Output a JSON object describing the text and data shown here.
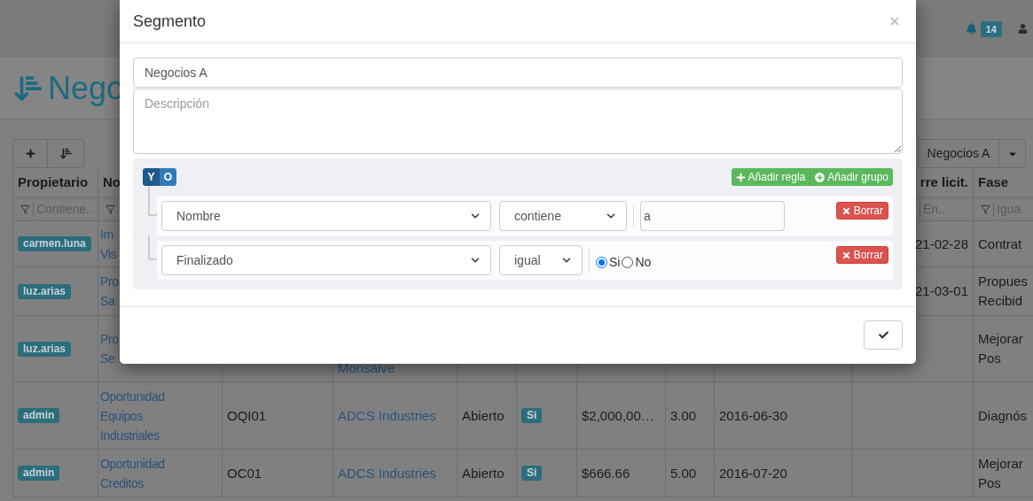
{
  "navbar": {
    "notification_count": "14"
  },
  "page": {
    "title": "Nego"
  },
  "segment_dropdown": {
    "value": "Negocios A"
  },
  "table": {
    "header": {
      "owner": "Propietario",
      "name": "No",
      "close_date": "rre licit.",
      "phase": "Fase"
    },
    "filters": {
      "owner": {
        "placeholder": "Contiene..",
        "funnel": true
      },
      "name": {
        "funnel": true
      },
      "close_date": {
        "placeholder": "En.."
      },
      "phase": {
        "placeholder": "Igua",
        "funnel": true
      }
    },
    "rows": [
      {
        "owner": "carmen.luna",
        "name": "Im\nVis",
        "close_date": "21-02-28",
        "phase": "Contrat"
      },
      {
        "owner": "luz.arias",
        "name": "Pro\nSa",
        "close_date": "21-03-01",
        "phase": "Propues\nRecibid"
      },
      {
        "owner": "luz.arias",
        "name": "Pro\nSe",
        "client": "Monsalve",
        "phase": "Mejorar\nPos"
      },
      {
        "owner": "admin",
        "name": "Oportunidad\nEquipos\nIndustriales",
        "code": "OQI01",
        "client": "ADCS Industries",
        "status": "Abierto",
        "won": "Si",
        "amount": "$2,000,00…",
        "probability": "3.00",
        "date": "2016-06-30",
        "phase": "Diagnós"
      },
      {
        "owner": "admin",
        "name": "Oportunidad\nCreditos",
        "code": "OC01",
        "client": "ADCS Industries",
        "status": "Abierto",
        "won": "Si",
        "amount": "$666.66",
        "probability": "5.00",
        "date": "2016-07-20",
        "phase": "Mejorar\nPos"
      }
    ]
  },
  "modal": {
    "title": "Segmento",
    "name_value": "Negocios A",
    "description_placeholder": "Descripción",
    "conditions": [
      {
        "label": "Y",
        "selected": true
      },
      {
        "label": "O",
        "selected": false
      }
    ],
    "actions": [
      {
        "kind": "rule",
        "label": "Añadir regla"
      },
      {
        "kind": "group",
        "label": "Añadir grupo"
      }
    ],
    "rules": [
      {
        "kind": "text",
        "field": "Nombre",
        "operator": "contiene",
        "value": "a",
        "delete_label": "Borrar"
      },
      {
        "kind": "boolean",
        "field": "Finalizado",
        "operator": "igual",
        "options": [
          {
            "label": "Si",
            "selected": true
          },
          {
            "label": "No",
            "selected": false
          }
        ],
        "delete_label": "Borrar"
      }
    ]
  }
}
